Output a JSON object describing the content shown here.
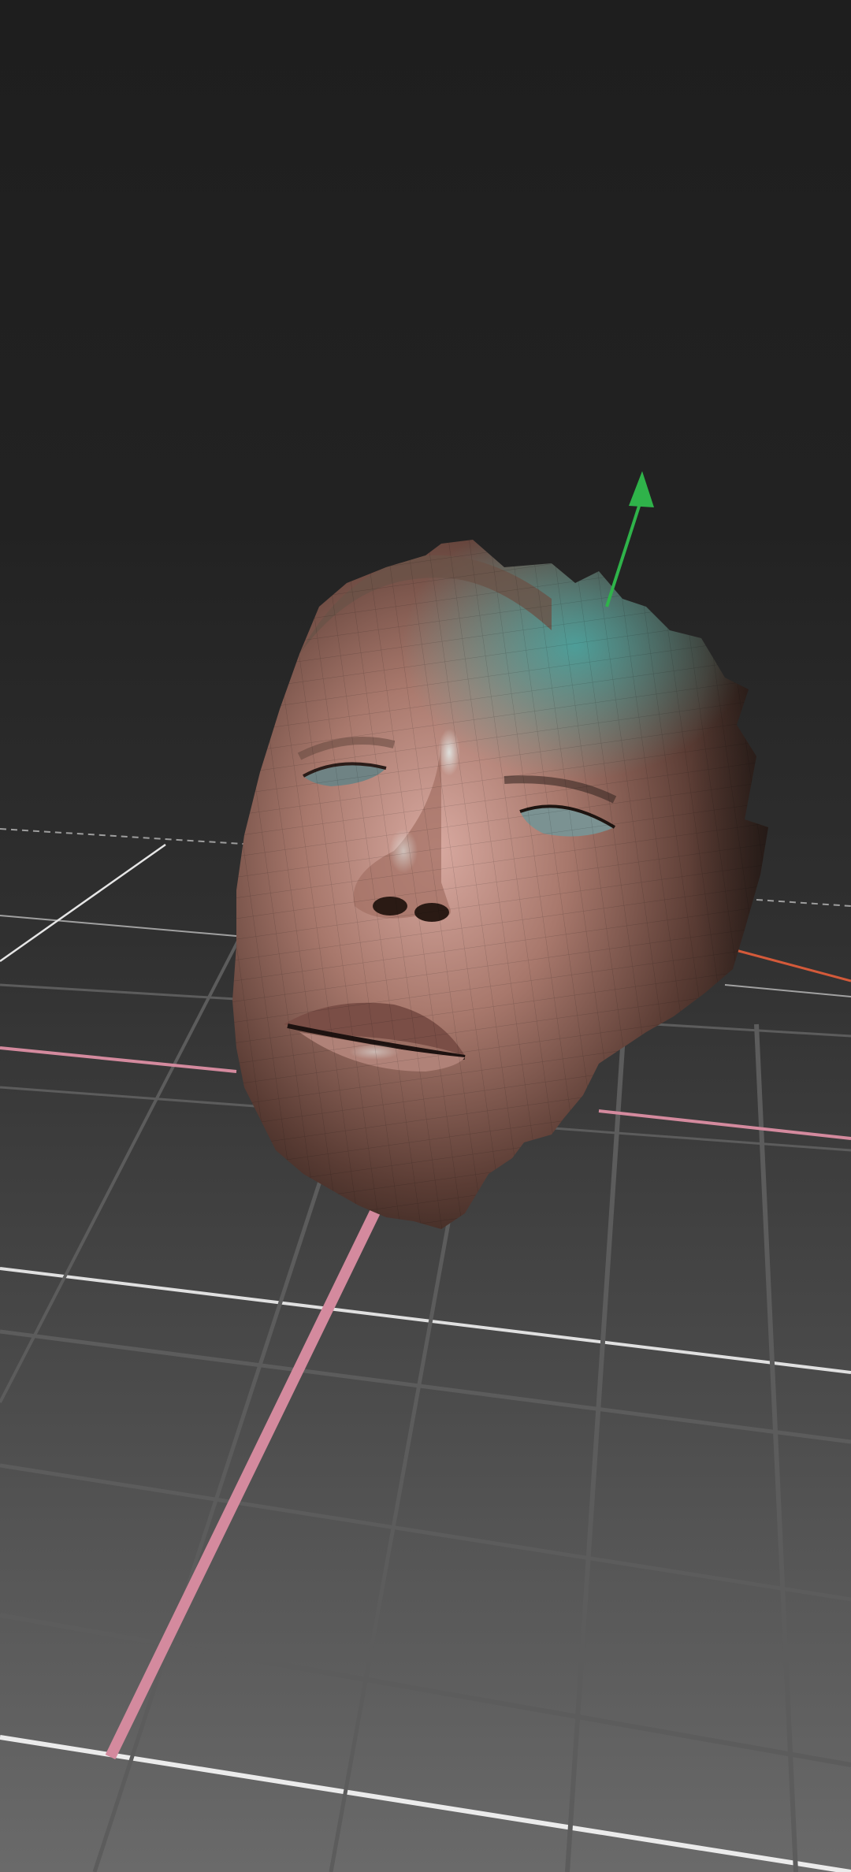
{
  "viewport": {
    "view": "perspective",
    "background_top_color": "#1e1e1e",
    "background_bottom_color": "#6a6a6a",
    "grid_visible": true,
    "grid_color": "#7a7a7a",
    "grid_major_color": "#cfcfcf",
    "x_axis_color": "#d48a9e",
    "z_axis_color": "#d45a3a",
    "y_axis_gizmo_color": "#2fb34a",
    "light_tint_color": "#3fb6b2"
  },
  "model": {
    "object": "face-scan-mesh",
    "wireframe_overlay": true,
    "skin_color": "#a8786c",
    "shadow_color": "#1c1410"
  },
  "gizmo": {
    "icon": "y-axis-arrow-icon"
  }
}
